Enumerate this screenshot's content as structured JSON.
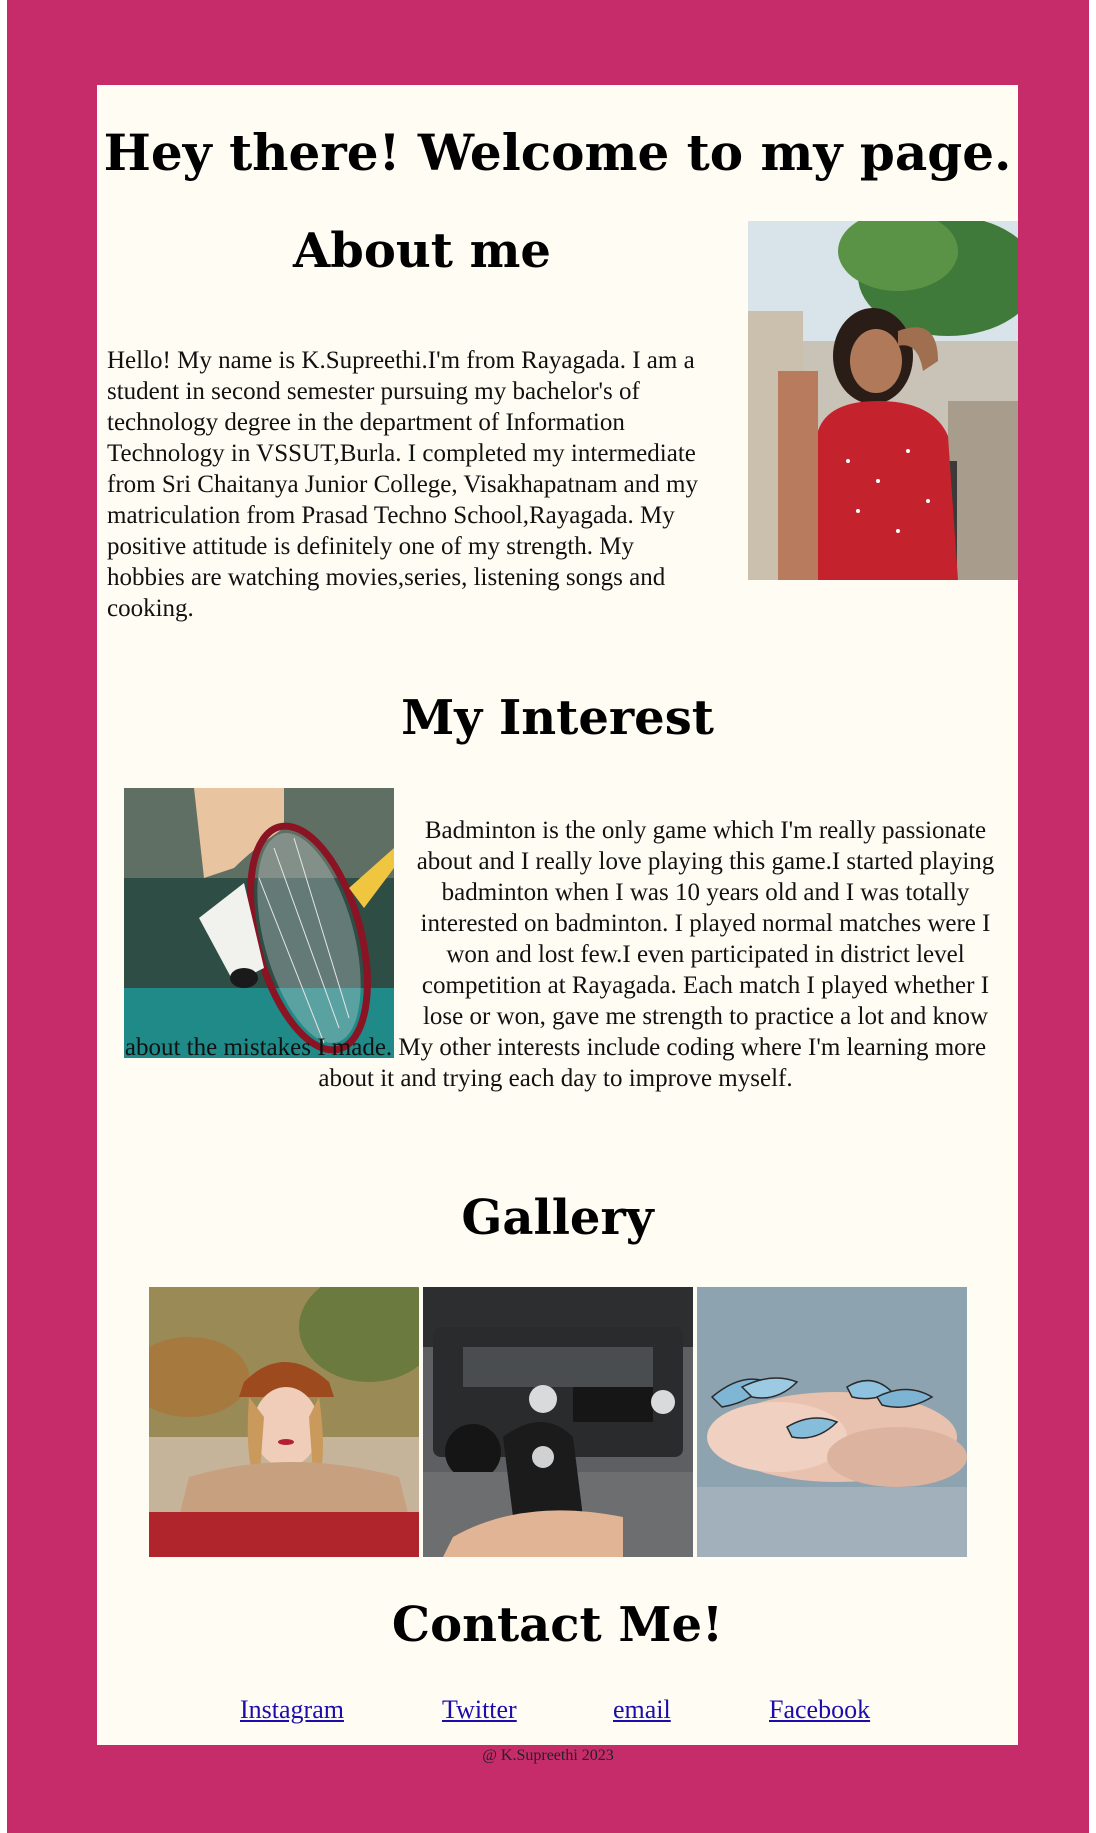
{
  "page": {
    "title": "Hey there! Welcome to my page.",
    "background_color": "#c72c6a",
    "card_color": "#fffcf4"
  },
  "about": {
    "heading": "About me",
    "text": "Hello! My name is K.Supreethi.I'm from Rayagada. I am a student in second semester pursuing my bachelor's of technology degree in the department of Information Technology in VSSUT,Burla. I completed my intermediate from Sri Chaitanya Junior College, Visakhapatnam and my matriculation from Prasad Techno School,Rayagada. My positive attitude is definitely one of my strength. My hobbies are watching movies,series, listening songs and cooking."
  },
  "interest": {
    "heading": "My Interest",
    "text": "Badminton is the only game which I'm really passionate about and I really love playing this game.I started playing badminton when I was 10 years old and I was totally interested on badminton. I played normal matches were I won and lost few.I even participated in district level competition at Rayagada. Each match I played whether I lose or won, gave me strength to practice a lot and know about the mistakes I made. My other interests include coding where I'm learning more about it and trying each day to improve myself."
  },
  "gallery": {
    "heading": "Gallery"
  },
  "contact": {
    "heading": "Contact Me!",
    "links": [
      {
        "label": "Instagram"
      },
      {
        "label": "Twitter"
      },
      {
        "label": "email "
      },
      {
        "label": "Facebook"
      }
    ]
  },
  "footer": {
    "text": "@ K.Supreethi 2023"
  }
}
